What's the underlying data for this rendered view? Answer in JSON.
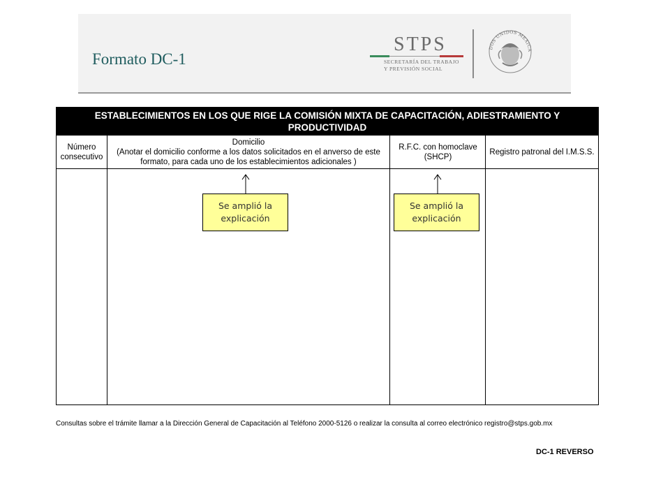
{
  "header": {
    "title": "Formato DC-1",
    "logo": {
      "name": "STPS",
      "subtitle_line1": "SECRETARÍA DEL TRABAJO",
      "subtitle_line2": "Y PREVISIÓN SOCIAL",
      "seal_text": "ESTADOS UNIDOS MEXICANOS"
    }
  },
  "form": {
    "heading_line1": "ESTABLECIMIENTOS EN LOS QUE RIGE LA COMISIÓN MIXTA DE CAPACITACIÓN, ADIESTRAMIENTO Y",
    "heading_line2": "PRODUCTIVIDAD",
    "columns": [
      {
        "line1": "Número",
        "line2": "consecutivo"
      },
      {
        "line1": "Domicilio",
        "line2": "(Anotar el domicilio conforme a los datos solicitados en el anverso de este",
        "line3": "formato, para cada uno de los establecimientos adicionales )"
      },
      {
        "line1": "R.F.C. con homoclave",
        "line2": "(SHCP)"
      },
      {
        "line1": "Registro patronal del I.M.S.S."
      }
    ]
  },
  "callouts": [
    {
      "line1": "Se amplió la",
      "line2": "explicación"
    },
    {
      "line1": "Se amplió la",
      "line2": "explicación"
    }
  ],
  "footnote": "Consultas sobre el trámite llamar a la Dirección General de Capacitación al Teléfono 2000-5126  o realizar la consulta al correo electrónico registro@stps.gob.mx",
  "footer_label": "DC-1 REVERSO",
  "colors": {
    "title": "#1f5c5e",
    "callout_bg": "#ffff99",
    "header_bg": "#000000"
  }
}
